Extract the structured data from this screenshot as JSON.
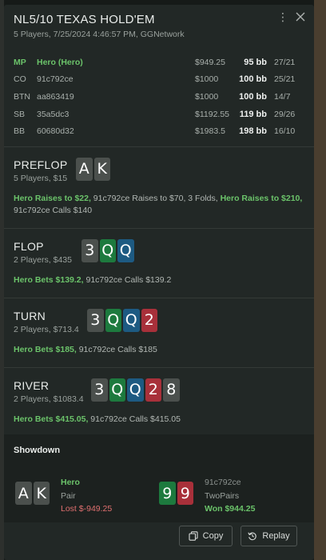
{
  "header": {
    "title": "NL5/10 TEXAS HOLD'EM",
    "subtitle": "5 Players, 7/25/2024 4:46:57 PM, GGNetwork"
  },
  "players": [
    {
      "pos": "MP",
      "name": "Hero (Hero)",
      "stack": "$949.25",
      "bb": "95 bb",
      "vpip": "27/21",
      "hero": true
    },
    {
      "pos": "CO",
      "name": "91c792ce",
      "stack": "$1000",
      "bb": "100 bb",
      "vpip": "25/21",
      "hero": false
    },
    {
      "pos": "BTN",
      "name": "aa863419",
      "stack": "$1000",
      "bb": "100 bb",
      "vpip": "14/7",
      "hero": false
    },
    {
      "pos": "SB",
      "name": "35a5dc3",
      "stack": "$1192.55",
      "bb": "119 bb",
      "vpip": "29/26",
      "hero": false
    },
    {
      "pos": "BB",
      "name": "60680d32",
      "stack": "$1983.5",
      "bb": "198 bb",
      "vpip": "16/10",
      "hero": false
    }
  ],
  "streets": {
    "preflop": {
      "name": "PREFLOP",
      "sub": "5 Players, $15",
      "cards": [
        {
          "rank": "A",
          "suit": "s"
        },
        {
          "rank": "K",
          "suit": "s"
        }
      ],
      "action": {
        "a1": "Hero Raises to $22,",
        "a2": " 91c792ce Raises to $70, 3 Folds, ",
        "a3": "Hero Raises to $210,",
        "a4": " 91c792ce Calls $140"
      }
    },
    "flop": {
      "name": "FLOP",
      "sub": "2 Players, $435",
      "cards": [
        {
          "rank": "3",
          "suit": "s"
        },
        {
          "rank": "Q",
          "suit": "c"
        },
        {
          "rank": "Q",
          "suit": "d"
        }
      ],
      "action": {
        "a1": "Hero Bets $139.2,",
        "a2": " 91c792ce Calls $139.2"
      }
    },
    "turn": {
      "name": "TURN",
      "sub": "2 Players, $713.4",
      "cards": [
        {
          "rank": "3",
          "suit": "s"
        },
        {
          "rank": "Q",
          "suit": "c"
        },
        {
          "rank": "Q",
          "suit": "d"
        },
        {
          "rank": "2",
          "suit": "h"
        }
      ],
      "action": {
        "a1": "Hero Bets $185,",
        "a2": " 91c792ce Calls $185"
      }
    },
    "river": {
      "name": "RIVER",
      "sub": "2 Players, $1083.4",
      "cards": [
        {
          "rank": "3",
          "suit": "s"
        },
        {
          "rank": "Q",
          "suit": "c"
        },
        {
          "rank": "Q",
          "suit": "d"
        },
        {
          "rank": "2",
          "suit": "h"
        },
        {
          "rank": "8",
          "suit": "s"
        }
      ],
      "action": {
        "a1": "Hero Bets $415.05,",
        "a2": " 91c792ce Calls $415.05"
      }
    }
  },
  "showdown": {
    "title": "Showdown",
    "hero": {
      "name": "Hero",
      "hand": "Pair",
      "result": "Lost $-949.25",
      "cards": [
        {
          "rank": "A",
          "suit": "s"
        },
        {
          "rank": "K",
          "suit": "s"
        }
      ]
    },
    "villain": {
      "name": "91c792ce",
      "hand": "TwoPairs",
      "result": "Won $944.25",
      "cards": [
        {
          "rank": "9",
          "suit": "c"
        },
        {
          "rank": "9",
          "suit": "h"
        }
      ]
    }
  },
  "footer": {
    "copy_label": "Copy",
    "replay_label": "Replay"
  },
  "icons": {
    "menu": "kebab-menu-icon",
    "close": "close-icon",
    "copy": "copy-icon",
    "replay": "replay-icon"
  },
  "colors": {
    "spade": "#4b504d",
    "club": "#1d7a3e",
    "diamond": "#1d5a82",
    "heart": "#a8303a",
    "hero_green": "#6bc36a",
    "loss_red": "#e07070"
  }
}
